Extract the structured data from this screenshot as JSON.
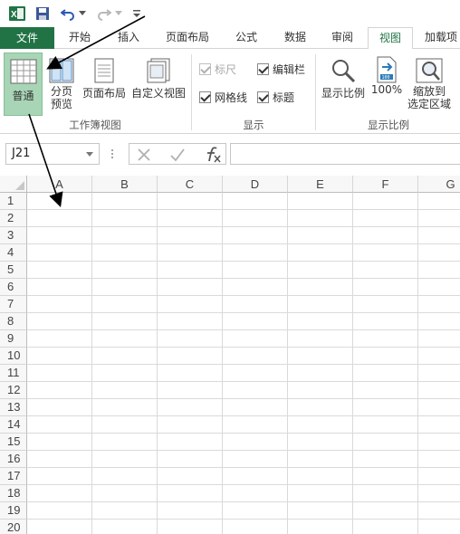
{
  "titlebar": {
    "icons": [
      "excel-logo-icon",
      "save-icon",
      "undo-icon",
      "undo-dropdown-icon",
      "redo-icon",
      "redo-dropdown-icon",
      "customize-qat-icon"
    ]
  },
  "tabs": [
    {
      "label": "文件",
      "name": "tab-file"
    },
    {
      "label": "开始",
      "name": "tab-home"
    },
    {
      "label": "插入",
      "name": "tab-insert"
    },
    {
      "label": "页面布局",
      "name": "tab-page-layout"
    },
    {
      "label": "公式",
      "name": "tab-formulas"
    },
    {
      "label": "数据",
      "name": "tab-data"
    },
    {
      "label": "审阅",
      "name": "tab-review"
    },
    {
      "label": "视图",
      "name": "tab-view",
      "active": true
    },
    {
      "label": "加载项",
      "name": "tab-addins"
    }
  ],
  "ribbon": {
    "workbook_views": {
      "group_label": "工作簿视图",
      "normal": "普通",
      "page_break_1": "分页",
      "page_break_2": "预览",
      "page_layout": "页面布局",
      "custom_views": "自定义视图"
    },
    "show": {
      "group_label": "显示",
      "ruler": "标尺",
      "ruler_checked": true,
      "ruler_disabled": true,
      "gridlines": "网格线",
      "gridlines_checked": true,
      "formula_bar": "编辑栏",
      "formula_bar_checked": true,
      "headings": "标题",
      "headings_checked": true
    },
    "zoom": {
      "group_label": "显示比例",
      "zoom": "显示比例",
      "zoom100": "100%",
      "zoom_sel_1": "缩放到",
      "zoom_sel_2": "选定区域"
    }
  },
  "formula_bar": {
    "name_box": "J21",
    "formula": ""
  },
  "grid": {
    "columns": [
      "A",
      "B",
      "C",
      "D",
      "E",
      "F",
      "G"
    ],
    "rows": [
      "1",
      "2",
      "3",
      "4",
      "5",
      "6",
      "7",
      "8",
      "9",
      "10",
      "11",
      "12",
      "13",
      "14",
      "15",
      "16",
      "17",
      "18",
      "19",
      "20"
    ]
  },
  "colors": {
    "excel_green": "#217346",
    "normal_btn_bg": "#a8d5b6",
    "annotation_arrow": "#000000"
  }
}
